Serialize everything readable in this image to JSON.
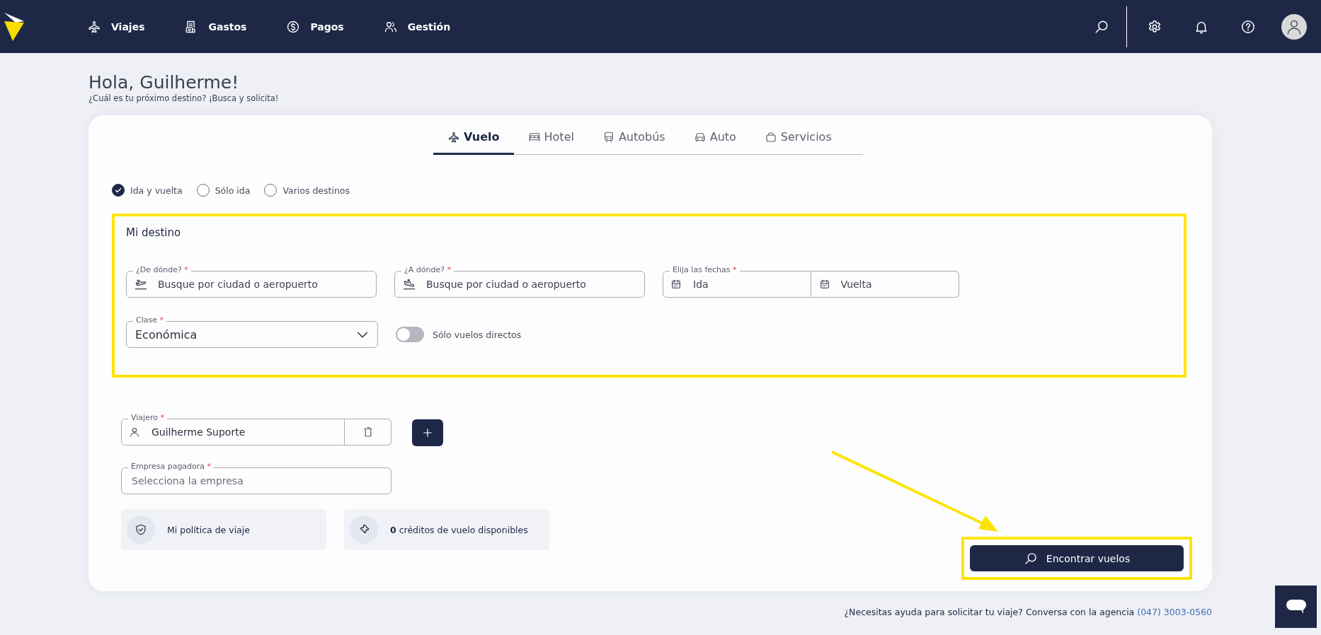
{
  "nav": {
    "items": [
      {
        "label": "Viajes"
      },
      {
        "label": "Gastos"
      },
      {
        "label": "Pagos"
      },
      {
        "label": "Gestión"
      }
    ]
  },
  "greeting": {
    "title": "Hola, Guilherme!",
    "subtitle": "¿Cuál es tu próximo destino? ¡Busca y solicita!"
  },
  "tabs": [
    {
      "label": "Vuelo",
      "selected": true
    },
    {
      "label": "Hotel",
      "selected": false
    },
    {
      "label": "Autobús",
      "selected": false
    },
    {
      "label": "Auto",
      "selected": false
    },
    {
      "label": "Servicios",
      "selected": false
    }
  ],
  "trip_types": [
    {
      "label": "Ida y vuelta",
      "selected": true
    },
    {
      "label": "Sólo ida",
      "selected": false
    },
    {
      "label": "Varios destinos",
      "selected": false
    }
  ],
  "destination": {
    "title": "Mi destino",
    "places": [
      {
        "label": "¿De dónde?",
        "required_mark": "*",
        "placeholder": "Busque por ciudad o aeropuerto"
      },
      {
        "label": "¿A dónde?",
        "required_mark": "*",
        "placeholder": "Busque por ciudad o aeropuerto"
      }
    ],
    "dates": {
      "label": "Elija las fechas",
      "required_mark": "*",
      "fields": [
        {
          "placeholder": "Ida"
        },
        {
          "placeholder": "Vuelta"
        }
      ]
    },
    "class": {
      "label": "Clase",
      "required_mark": "*",
      "value": "Económica"
    },
    "direct_flights": {
      "label": "Sólo vuelos directos",
      "on": false
    }
  },
  "traveler": {
    "label": "Viajero",
    "required_mark": "*",
    "value": "Guilherme Suporte"
  },
  "company": {
    "label": "Empresa pagadora",
    "required_mark": "*",
    "placeholder": "Selecciona la empresa"
  },
  "info_cards": [
    {
      "text": "Mi política de viaje"
    },
    {
      "text": "**0** créditos de vuelo disponibles"
    }
  ],
  "search_button": {
    "label": "Encontrar vuelos"
  },
  "footer": {
    "text": "¿Necesitas ayuda para solicitar tu viaje? Conversa con la agencia",
    "phone": "(047) 3003-0560"
  }
}
